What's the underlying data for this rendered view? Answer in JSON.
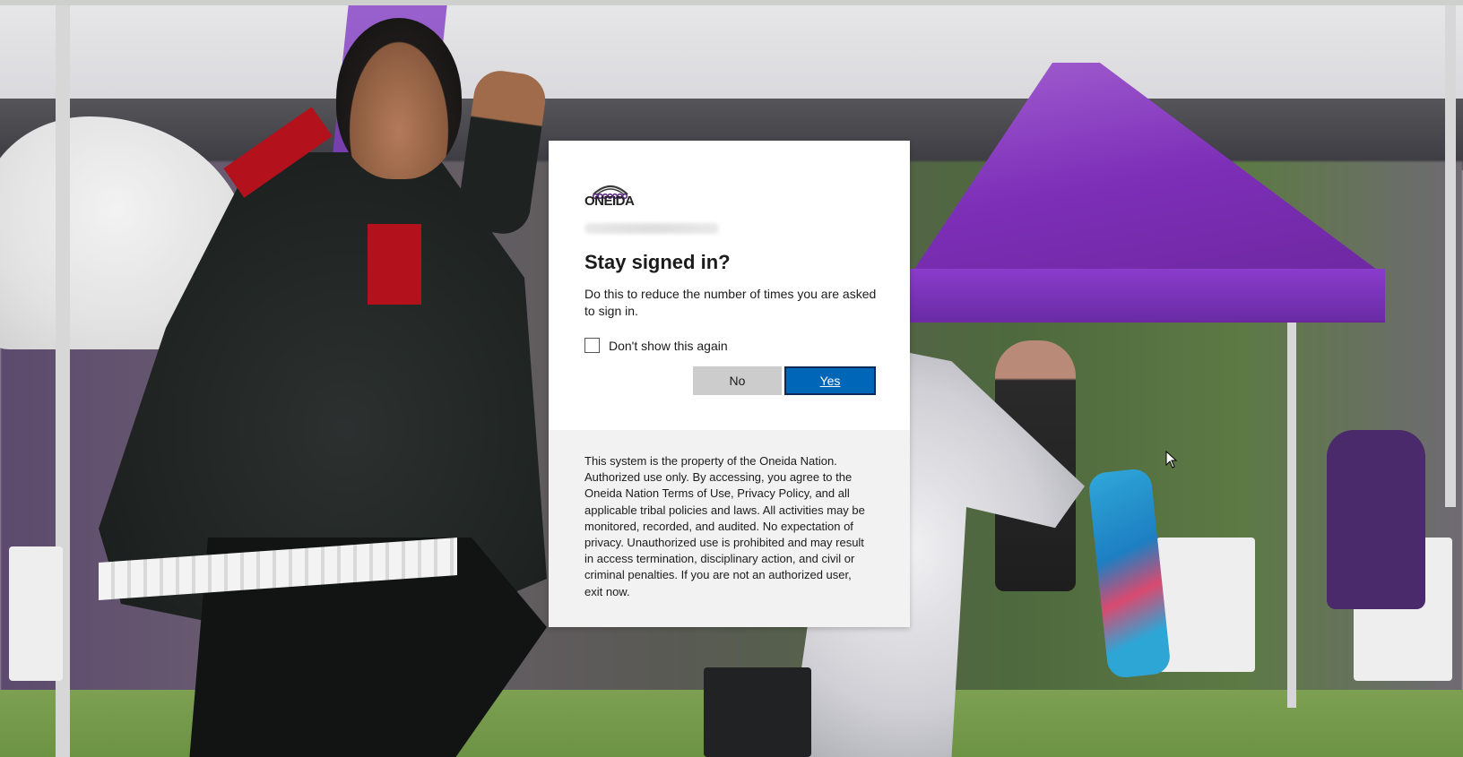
{
  "org": {
    "logo_text": "ONEIDA"
  },
  "dialog": {
    "title": "Stay signed in?",
    "description": "Do this to reduce the number of times you are asked to sign in.",
    "checkbox_label": "Don't show this again",
    "checkbox_checked": false,
    "no_label": "No",
    "yes_label": "Yes",
    "disclaimer": "This system is the property of the Oneida Nation. Authorized use only. By accessing, you agree to the Oneida Nation Terms of Use, Privacy Policy, and all applicable tribal policies and laws. All activities may be monitored, recorded, and audited. No expectation of privacy. Unauthorized use is prohibited and may result in access termination, disciplinary action, and civil or criminal penalties. If you are not an authorized user, exit now."
  },
  "colors": {
    "primary_button": "#0067b8",
    "secondary_button": "#cccccc",
    "footer_background": "#f2f2f2",
    "logo_accent": "#5b2a86"
  },
  "icons": {
    "logo": "oneida-logo-icon",
    "cursor": "mouse-pointer-icon"
  }
}
